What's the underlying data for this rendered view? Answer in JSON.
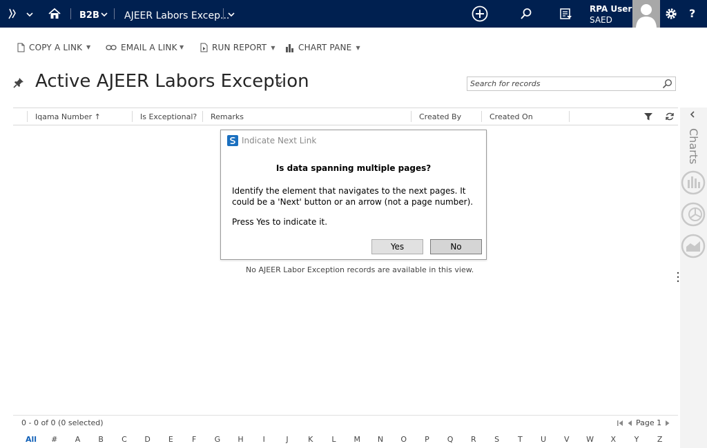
{
  "topbar": {
    "area": "B2B",
    "entity": "AJEER Labors Excep...",
    "user_name": "RPA User",
    "user_org": "SAED",
    "help": "?",
    "bg_color": "#002050"
  },
  "commands": {
    "copy_link": "COPY A LINK",
    "email_link": "EMAIL A LINK",
    "run_report": "RUN REPORT",
    "chart_pane": "CHART PANE"
  },
  "view": {
    "title": "Active AJEER Labors Exception",
    "search_placeholder": "Search for records"
  },
  "grid": {
    "columns": [
      "Iqama Number",
      "Is Exceptional?",
      "Remarks",
      "Created By",
      "Created On"
    ],
    "sort_indicator": "↑",
    "empty_message": "No AJEER Labor Exception records are available in this view."
  },
  "dialog": {
    "title": "Indicate Next Link",
    "question": "Is data spanning multiple pages?",
    "body": "Identify the element that navigates to the next pages. It could be a 'Next' button or an arrow (not a page number).",
    "body2": "Press Yes to indicate it.",
    "yes": "Yes",
    "no": "No"
  },
  "charts_pane": {
    "label": "Charts"
  },
  "footer": {
    "record_count": "0 - 0 of 0 (0 selected)",
    "page_label": "Page 1",
    "alpha": [
      "All",
      "#",
      "A",
      "B",
      "C",
      "D",
      "E",
      "F",
      "G",
      "H",
      "I",
      "J",
      "K",
      "L",
      "M",
      "N",
      "O",
      "P",
      "Q",
      "R",
      "S",
      "T",
      "U",
      "V",
      "W",
      "X",
      "Y",
      "Z"
    ],
    "active_letter": "All",
    "accent_color": "#1160b7"
  }
}
